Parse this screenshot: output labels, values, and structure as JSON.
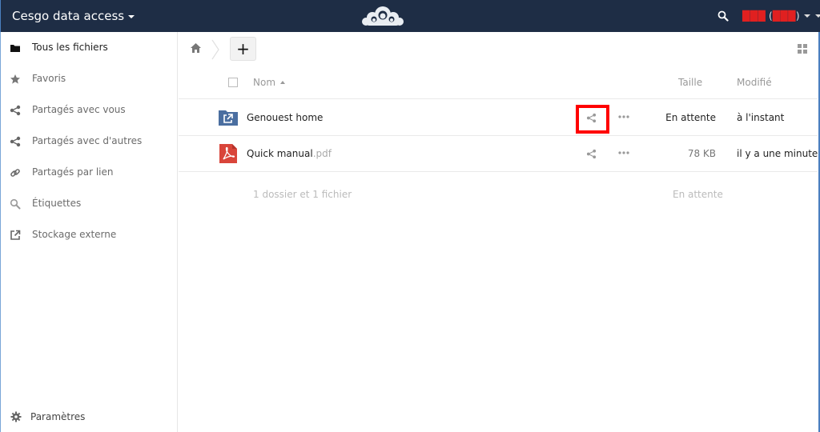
{
  "header": {
    "app_title": "Cesgo data access",
    "logo_icon": "owncloud-cloud-logo",
    "search_icon": "search-icon",
    "user_name": "███",
    "user_id": "███",
    "background": "#1e2d45"
  },
  "sidebar": {
    "items": [
      {
        "label": "Tous les fichiers",
        "icon": "folder-icon",
        "active": true
      },
      {
        "label": "Favoris",
        "icon": "star-icon",
        "active": false
      },
      {
        "label": "Partagés avec vous",
        "icon": "share-icon",
        "active": false
      },
      {
        "label": "Partagés avec d'autres",
        "icon": "share-icon",
        "active": false
      },
      {
        "label": "Partagés par lien",
        "icon": "link-icon",
        "active": false
      },
      {
        "label": "Étiquettes",
        "icon": "tag-search-icon",
        "active": false
      },
      {
        "label": "Stockage externe",
        "icon": "external-link-icon",
        "active": false
      }
    ],
    "settings_label": "Paramètres"
  },
  "controls": {
    "new_label": "+"
  },
  "table": {
    "columns": {
      "name": "Nom",
      "size": "Taille",
      "modified": "Modifié"
    },
    "rows": [
      {
        "name": "Genouest home",
        "ext": "",
        "type": "external-folder",
        "size": "En attente",
        "modified": "à l'instant"
      },
      {
        "name": "Quick manual",
        "ext": ".pdf",
        "type": "pdf",
        "size": "78 KB",
        "modified": "il y a une minute"
      }
    ],
    "summary": {
      "count": "1 dossier et 1 fichier",
      "total_size": "En attente"
    }
  },
  "colors": {
    "accent": "#1d2d44",
    "folder": "#4a6ea0",
    "pdf": "#d9453a",
    "highlight": "#ff0000"
  }
}
